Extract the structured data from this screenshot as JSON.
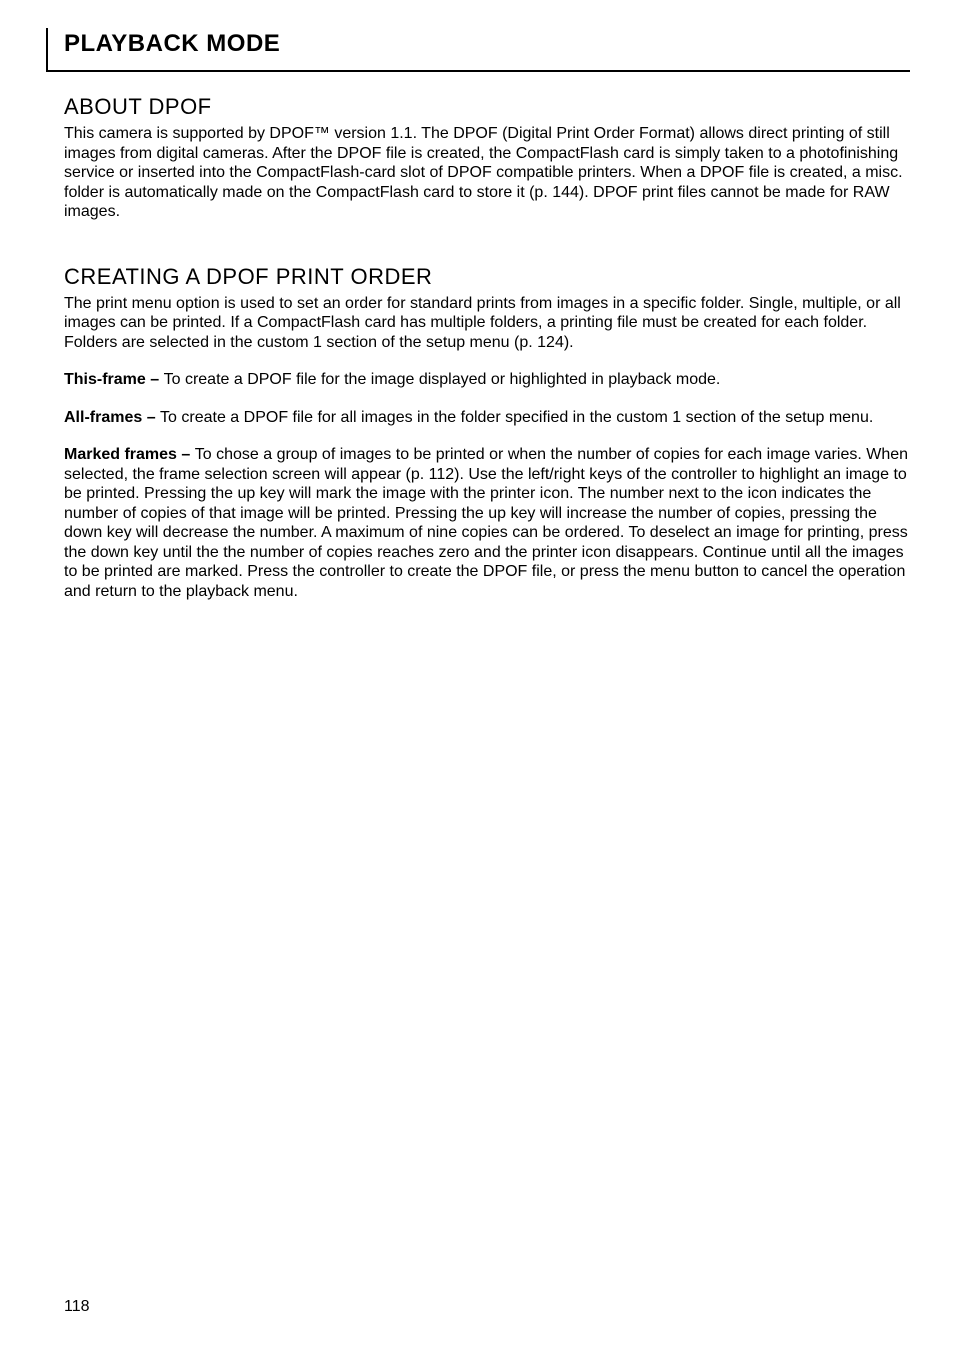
{
  "header": {
    "title": "PLAYBACK MODE"
  },
  "sections": {
    "about": {
      "heading": "ABOUT DPOF",
      "p1": "This camera is supported by DPOF™ version 1.1. The DPOF (Digital Print Order Format) allows direct printing of still images from digital cameras. After the DPOF file is created, the CompactFlash card is simply taken to a photofinishing service or inserted into the CompactFlash-card slot of DPOF compatible printers. When a DPOF file is created, a misc. folder is automatically made on the CompactFlash card to store it (p. 144). DPOF print files cannot be made for RAW images."
    },
    "creating": {
      "heading": "CREATING A DPOF PRINT ORDER",
      "p1": "The print menu option is used to set an order for standard prints from images in a specific folder. Single, multiple, or all images can be printed. If a CompactFlash card has multiple folders, a printing file must be created for each folder. Folders are selected in the custom 1 section of the setup menu (p. 124).",
      "thisFrameLabel": "This-frame – ",
      "thisFrameText": "To create a DPOF file for the image displayed or highlighted in playback mode.",
      "allFramesLabel": "All-frames – ",
      "allFramesText": "To create a DPOF file for all images in the folder specified in the custom 1 section of the setup menu.",
      "markedFramesLabel": "Marked frames – ",
      "markedFramesText": "To chose a group of images to be printed or when the number of copies for each image varies. When selected, the frame selection screen will appear (p. 112). Use the left/right keys of the controller to highlight an image to be printed. Pressing the up key will mark the image with the printer icon. The number next to the icon indicates the number of copies of that image will be printed. Pressing the up key will increase the number of copies, pressing the down key will decrease the number. A maximum of nine copies can be ordered. To deselect an image for printing, press the down key until the the number of copies reaches zero and the printer icon disappears. Continue until all the images to be printed are marked. Press the controller to create the DPOF file, or press the menu button to cancel the operation and return to the playback menu."
    }
  },
  "pageNumber": "118"
}
